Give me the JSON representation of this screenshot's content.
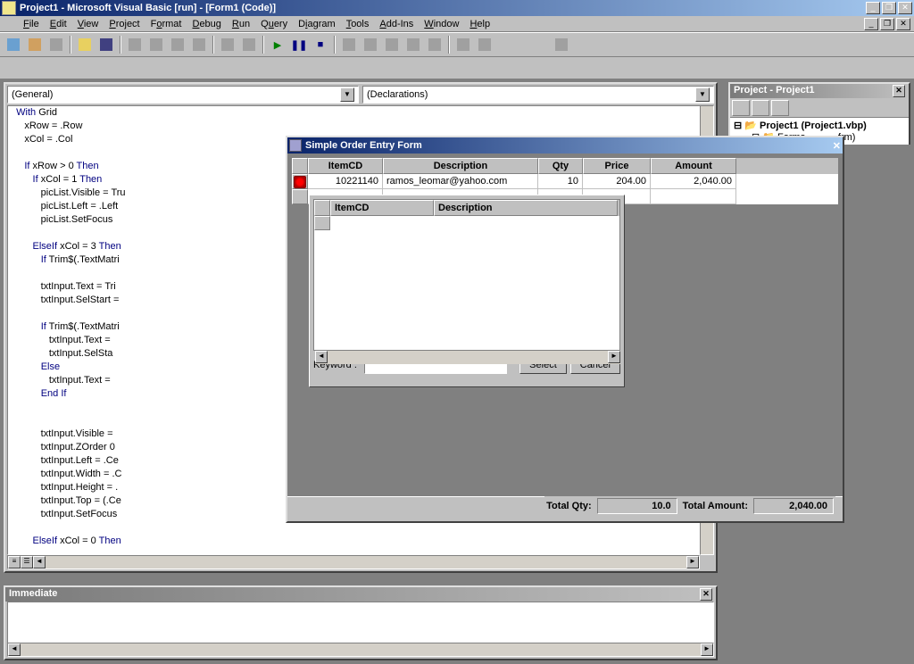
{
  "app": {
    "title": "Project1 - Microsoft Visual Basic [run] - [Form1 (Code)]"
  },
  "menu": [
    "File",
    "Edit",
    "View",
    "Project",
    "Format",
    "Debug",
    "Run",
    "Query",
    "Diagram",
    "Tools",
    "Add-Ins",
    "Window",
    "Help"
  ],
  "code_combos": {
    "left": "(General)",
    "right": "(Declarations)"
  },
  "code_lines": [
    "   With Grid",
    "      xRow = .Row",
    "      xCol = .Col",
    "",
    "      If xRow > 0 Then",
    "         If xCol = 1 Then",
    "            picList.Visible = Tru",
    "            picList.Left = .Left",
    "            picList.SetFocus",
    "",
    "         ElseIf xCol = 3 Then",
    "            If Trim$(.TextMatri",
    "",
    "            txtInput.Text = Tri",
    "            txtInput.SelStart =",
    "",
    "            If Trim$(.TextMatri",
    "               txtInput.Text =",
    "               txtInput.SelSta",
    "            Else",
    "               txtInput.Text =",
    "            End If",
    "",
    "",
    "            txtInput.Visible =",
    "            txtInput.ZOrder 0",
    "            txtInput.Left = .Ce",
    "            txtInput.Width = .C",
    "            txtInput.Height = .",
    "            txtInput.Top = (.Ce",
    "            txtInput.SetFocus",
    "",
    "         ElseIf xCol = 0 Then"
  ],
  "project_panel": {
    "title": "Project - Project1",
    "root": "Project1 (Project1.vbp)",
    "folder": "Forms",
    "item_tail": "frm)"
  },
  "immediate": {
    "title": "Immediate"
  },
  "order_form": {
    "title": "Simple Order Entry Form",
    "columns": [
      "ItemCD",
      "Description",
      "Qty",
      "Price",
      "Amount"
    ],
    "row": {
      "itemcd": "10221140",
      "desc": "ramos_leomar@yahoo.com",
      "qty": "10",
      "price": "204.00",
      "amount": "2,040.00"
    },
    "lookup_cols": [
      "ItemCD",
      "Description"
    ],
    "keyword_label": "Keyword :",
    "keyword_value": "",
    "btn_select": "Select",
    "btn_cancel": "Cancel",
    "total_qty_label": "Total Qty:",
    "total_qty": "10.0",
    "total_amount_label": "Total Amount:",
    "total_amount": "2,040.00"
  }
}
